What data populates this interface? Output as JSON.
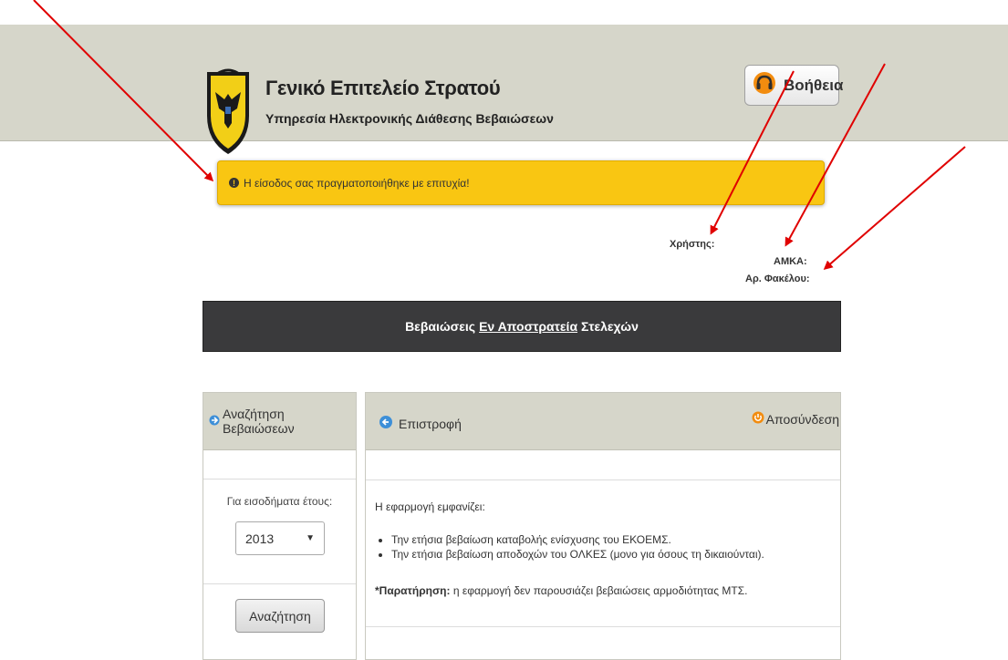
{
  "header": {
    "title": "Γενικό Επιτελείο Στρατού",
    "subtitle": "Υπηρεσία Ηλεκτρονικής Διάθεσης Βεβαιώσεων",
    "help_label": "Βοήθεια",
    "logo_alt": "ΓΕΝΙΚΟ ΕΠΙΤΕΛΕΙΟ ΣΤΡΑΤΟΥ"
  },
  "alert": {
    "message": "Η είσοδος σας πραγματοποιήθηκε με επιτυχία!"
  },
  "user_info": {
    "user_label": "Χρήστης:",
    "amka_label": "ΑΜΚΑ:",
    "file_label": "Αρ. Φακέλου:"
  },
  "banner": {
    "part1": "Βεβαιώσεις",
    "link": "Εν Αποστρατεία",
    "part2": "Στελεχών"
  },
  "left_panel": {
    "title": "Αναζήτηση Βεβαιώσεων",
    "year_label": "Για εισοδήματα έτους:",
    "year_value": "2013",
    "search_button": "Αναζήτηση"
  },
  "right_panel": {
    "back_label": "Επιστροφή",
    "logout_label": "Αποσύνδεση",
    "intro": "Η εφαρμογή εμφανίζει:",
    "items": [
      "Την ετήσια βεβαίωση καταβολής ενίσχυσης του ΕΚΟΕΜΣ.",
      "Την ετήσια βεβαίωση αποδοχών του ΟΛΚΕΣ (μονο για όσους τη δικαιούνται)."
    ],
    "note_label": "*Παρατήρηση:",
    "note_text": " η εφαρμογή δεν παρουσιάζει βεβαιώσεις αρμοδιότητας ΜΤΣ."
  },
  "colors": {
    "header_bg": "#d6d6ca",
    "alert_bg": "#f9c612",
    "banner_bg": "#3a3a3c",
    "annotation_arrow": "#e00000"
  }
}
